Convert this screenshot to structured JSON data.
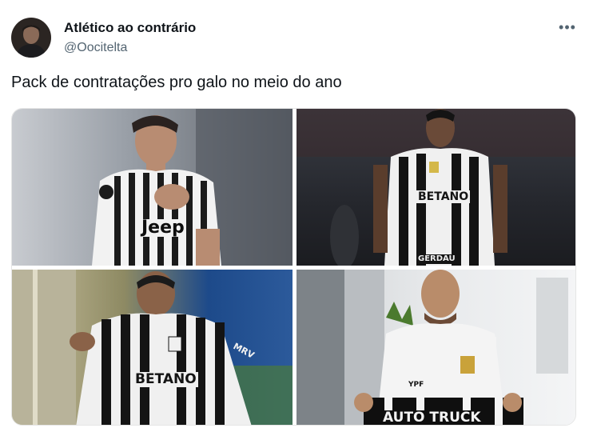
{
  "author": {
    "display_name": "Atlético ao contrário",
    "handle": "@Oocitelta"
  },
  "menu": {
    "more_label": "•••"
  },
  "tweet": {
    "text": "Pack de contratações pro galo no meio do ano"
  },
  "media": {
    "photos": [
      {
        "shirt_text": "Jeep"
      },
      {
        "shirt_text": "BETANO",
        "sponsor_text": "GERDAU"
      },
      {
        "shirt_text": "BETANO",
        "sleeve_text": "MRV"
      },
      {
        "shirt_text": "AUTO TRUCK",
        "badge_text": "YPF"
      }
    ]
  },
  "colors": {
    "text_primary": "#0f1419",
    "text_secondary": "#536471",
    "background": "#ffffff"
  }
}
